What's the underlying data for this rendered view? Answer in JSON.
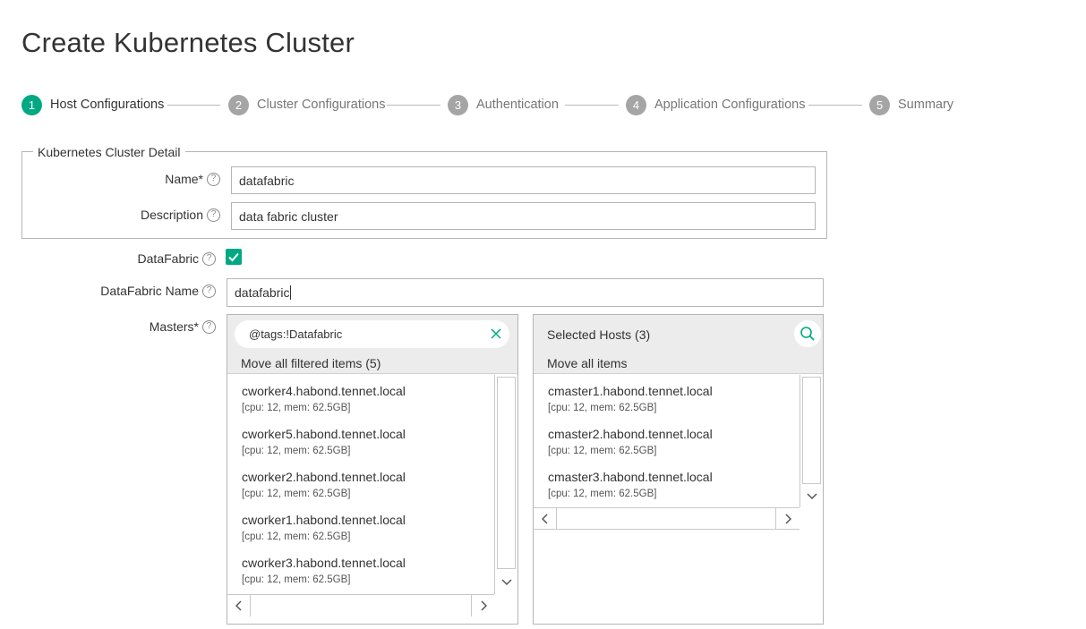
{
  "page": {
    "title": "Create Kubernetes Cluster"
  },
  "wizard": {
    "steps": [
      {
        "number": "1",
        "label": "Host Configurations",
        "active": true
      },
      {
        "number": "2",
        "label": "Cluster Configurations",
        "active": false
      },
      {
        "number": "3",
        "label": "Authentication",
        "active": false
      },
      {
        "number": "4",
        "label": "Application Configurations",
        "active": false
      },
      {
        "number": "5",
        "label": "Summary",
        "active": false
      }
    ]
  },
  "cluster_detail": {
    "legend": "Kubernetes Cluster Detail",
    "name_label": "Name*",
    "name_value": "datafabric",
    "description_label": "Description",
    "description_value": "data fabric cluster"
  },
  "datafabric": {
    "label": "DataFabric",
    "checked": true,
    "name_label": "DataFabric Name",
    "name_value": "datafabric"
  },
  "masters": {
    "label": "Masters*",
    "available": {
      "filter_value": "@tags:!Datafabric",
      "move_all_label": "Move all filtered items (5)",
      "items": [
        {
          "name": "cworker4.habond.tennet.local",
          "spec": "[cpu: 12, mem: 62.5GB]"
        },
        {
          "name": "cworker5.habond.tennet.local",
          "spec": "[cpu: 12, mem: 62.5GB]"
        },
        {
          "name": "cworker2.habond.tennet.local",
          "spec": "[cpu: 12, mem: 62.5GB]"
        },
        {
          "name": "cworker1.habond.tennet.local",
          "spec": "[cpu: 12, mem: 62.5GB]"
        },
        {
          "name": "cworker3.habond.tennet.local",
          "spec": "[cpu: 12, mem: 62.5GB]"
        }
      ]
    },
    "selected": {
      "title": "Selected Hosts (3)",
      "move_all_label": "Move all items",
      "items": [
        {
          "name": "cmaster1.habond.tennet.local",
          "spec": "[cpu: 12, mem: 62.5GB]"
        },
        {
          "name": "cmaster2.habond.tennet.local",
          "spec": "[cpu: 12, mem: 62.5GB]"
        },
        {
          "name": "cmaster3.habond.tennet.local",
          "spec": "[cpu: 12, mem: 62.5GB]"
        }
      ]
    }
  },
  "colors": {
    "accent": "#01a982",
    "inactive_step": "#a5a5a5",
    "panel_header": "#ececec"
  }
}
